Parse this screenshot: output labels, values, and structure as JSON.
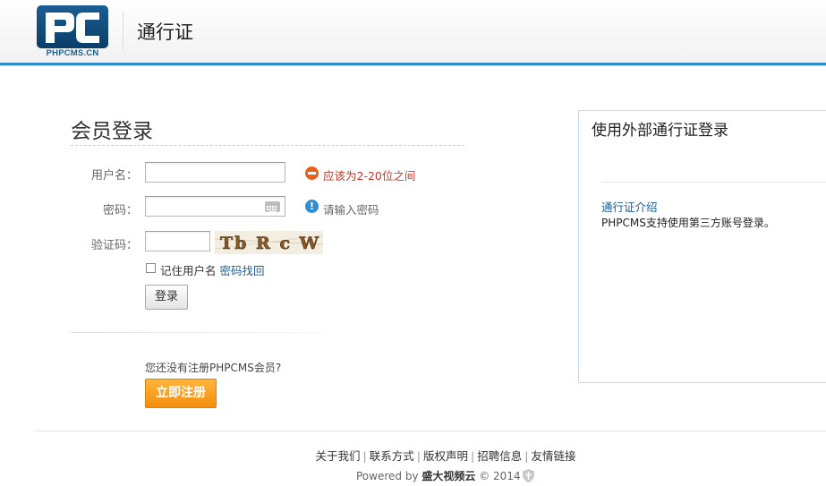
{
  "header": {
    "logo_text": "PHPCMS.CN",
    "title": "通行证"
  },
  "login": {
    "title": "会员登录",
    "username_label": "用户名：",
    "username_error": "应该为2-20位之间",
    "password_label": "密码：",
    "password_hint": "请输入密码",
    "captcha_label": "验证码：",
    "captcha_text": "Tb R c W",
    "remember_label": "记住用户名",
    "forgot_link": "密码找回",
    "login_button": "登录",
    "register_prompt": "您还没有注册PHPCMS会员?",
    "register_button": "立即注册"
  },
  "external": {
    "title": "使用外部通行证登录",
    "intro_link": "通行证介绍",
    "description": "PHPCMS支持使用第三方账号登录。"
  },
  "footer": {
    "links": [
      "关于我们",
      "联系方式",
      "版权声明",
      "招聘信息",
      "友情链接"
    ],
    "powered_prefix": "Powered by",
    "brand": "盛大视频云",
    "copyright": "© 2014"
  },
  "colors": {
    "accent_blue": "#2f8fca",
    "error_orange": "#e8601a",
    "error_text": "#c0392b",
    "register_orange": "#f58e0d",
    "link_blue": "#1f5e99"
  }
}
